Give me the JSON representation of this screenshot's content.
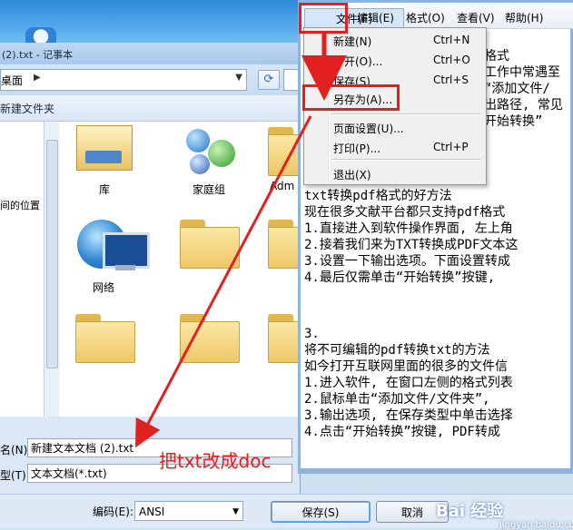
{
  "dialog": {
    "title_fragment": "(2).txt - 记事本",
    "address": "桌面",
    "toolbar_label": "新建文件夹",
    "nav_label": "间的位置",
    "files": [
      {
        "name": "库",
        "icon": "library-icon"
      },
      {
        "name": "家庭组",
        "icon": "homegroup-icon"
      },
      {
        "name": "Adm",
        "icon": "folder-icon"
      },
      {
        "name": "网络",
        "icon": "network-icon"
      },
      {
        "name": "",
        "icon": "folder-icon"
      },
      {
        "name": "",
        "icon": "folder-icon"
      }
    ],
    "filename_label": "名(N):",
    "filename_value": "新建文本文档 (2).txt",
    "type_label": "型(T):",
    "type_value": "文本文档(*.txt)",
    "encoding_label": "编码(E):",
    "encoding_value": "ANSI",
    "save_button": "保存(S)",
    "cancel_button": "取消"
  },
  "notepad": {
    "menu": [
      "文件(F)",
      "编辑(E)",
      "格式(O)",
      "查看(V)",
      "帮助(H)"
    ],
    "file_menu_items": [
      {
        "label": "新建(N)",
        "shortcut": "Ctrl+N"
      },
      {
        "label": "打开(O)...",
        "shortcut": "Ctrl+O"
      },
      {
        "label": "保存(S)",
        "shortcut": "Ctrl+S"
      },
      {
        "label": "另存为(A)...",
        "shortcut": ""
      },
      {
        "label": "页面设置(U)...",
        "shortcut": ""
      },
      {
        "label": "打印(P)...",
        "shortcut": "Ctrl+P"
      },
      {
        "label": "退出(X)",
        "shortcut": ""
      }
    ],
    "partial_top_lines": [
      "格式",
      "工作中常遇至",
      "“添加文件/",
      "出路径, 常见",
      "开始转换”"
    ],
    "lines": [
      "txt转换pdf格式的好方法",
      "现在很多文献平台都只支持pdf格式",
      "1.直接进入到软件操作界面, 左上角",
      "2.接着我们来为TXT转换成PDF文本这",
      "3.设置一下输出选项。下面设置转成",
      "4.最后仅需单击“开始转换”按键,",
      "",
      "",
      "3.",
      "将不可编辑的pdf转换txt的方法",
      "如今打开互联网里面的很多的文件信",
      "1.进入软件, 在窗口左侧的格式列表",
      "2.鼠标单击“添加文件/文件夹”,",
      "3.输出选项, 在保存类型中单击选择",
      "4.点击“开始转换”按键, PDF转成"
    ]
  },
  "annotation": {
    "text": "把txt改成doc",
    "color": "#e32020"
  },
  "watermark": {
    "text": "Bai 经验",
    "sub": "jingyan.baidu.com"
  }
}
